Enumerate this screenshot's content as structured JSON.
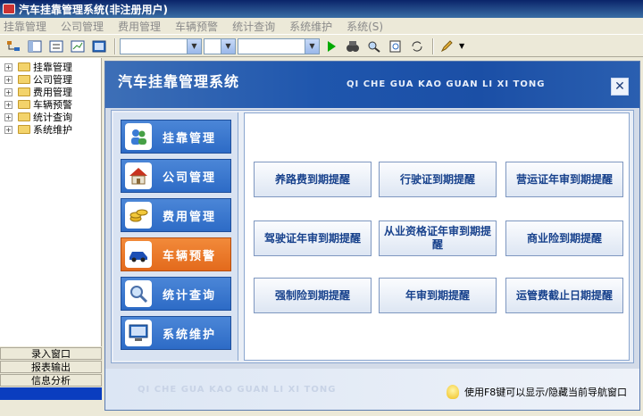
{
  "window": {
    "title": "汽车挂靠管理系统(非注册用户)"
  },
  "menu": [
    "挂靠管理",
    "公司管理",
    "费用管理",
    "车辆预警",
    "统计查询",
    "系统维护",
    "系统(S)"
  ],
  "tree": [
    "挂靠管理",
    "公司管理",
    "费用管理",
    "车辆预警",
    "统计查询",
    "系统维护"
  ],
  "bottom_tabs": [
    "录入窗口",
    "报表输出",
    "信息分析",
    ""
  ],
  "banner": {
    "title": "汽车挂靠管理系统",
    "subtitle": "QI CHE GUA KAO GUAN LI XI TONG"
  },
  "nav": [
    {
      "label": "挂靠管理",
      "icon": "people-icon"
    },
    {
      "label": "公司管理",
      "icon": "house-icon"
    },
    {
      "label": "费用管理",
      "icon": "coins-icon"
    },
    {
      "label": "车辆预警",
      "icon": "car-icon",
      "active": true
    },
    {
      "label": "统计查询",
      "icon": "magnifier-icon"
    },
    {
      "label": "系统维护",
      "icon": "monitor-icon"
    }
  ],
  "reminders": [
    "养路费到期提醒",
    "行驶证到期提醒",
    "营运证年审到期提醒",
    "驾驶证年审到期提醒",
    "从业资格证年审到期提醒",
    "商业险到期提醒",
    "强制险到期提醒",
    "年审到期提醒",
    "运管费截止日期提醒"
  ],
  "footer": {
    "subtitle": "QI CHE GUA KAO GUAN LI XI TONG",
    "tip": "使用F8键可以显示/隐藏当前导航窗口"
  },
  "colors": {
    "accent": "#1f56ad",
    "active": "#e36a1c"
  }
}
